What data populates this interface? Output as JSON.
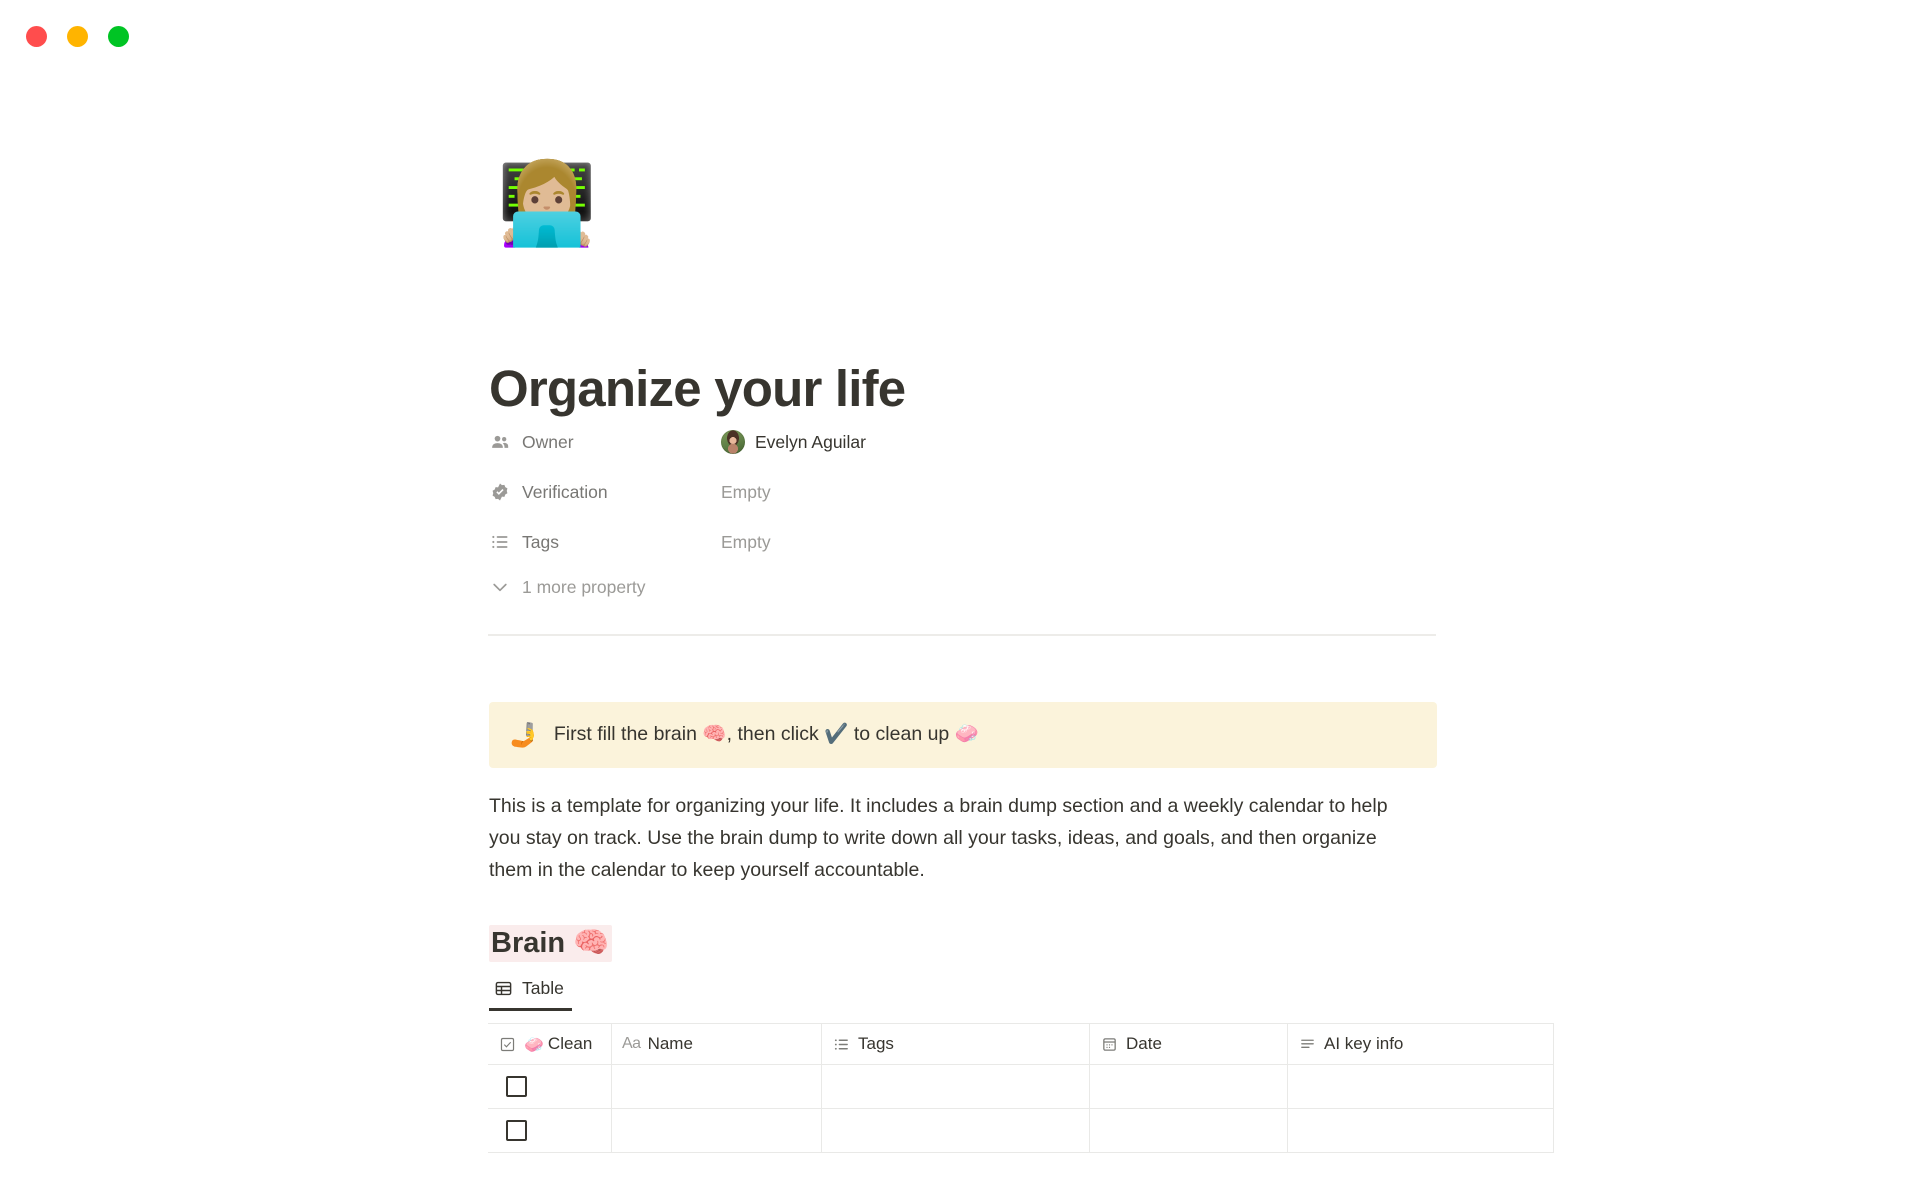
{
  "window": {
    "traffic_lights": [
      {
        "name": "close-button",
        "color": "#FF4D4D"
      },
      {
        "name": "minimize-button",
        "color": "#FFB400"
      },
      {
        "name": "maximize-button",
        "color": "#00C424"
      }
    ]
  },
  "page": {
    "emoji": "👩🏼‍💻",
    "title": "Organize your life"
  },
  "properties": {
    "rows": [
      {
        "icon": "people-icon",
        "label": "Owner",
        "value": "Evelyn Aguilar",
        "empty": false,
        "has_avatar": true
      },
      {
        "icon": "verified-badge-icon",
        "label": "Verification",
        "value": "Empty",
        "empty": true,
        "has_avatar": false
      },
      {
        "icon": "multi-select-icon",
        "label": "Tags",
        "value": "Empty",
        "empty": true,
        "has_avatar": false
      }
    ],
    "more_label": "1 more property",
    "more_icon": "chevron-down-icon"
  },
  "callout": {
    "emoji": "🤳",
    "text": "First fill the brain 🧠, then click ✔️ to clean up 🧼",
    "background": "#FBF3DB"
  },
  "intro": {
    "paragraph": "This is a template for organizing your life. It includes a brain dump section and a weekly calendar to help you stay on track. Use the brain dump to write down all your tasks, ideas, and goals, and then organize them in the calendar to keep yourself accountable."
  },
  "brain_section": {
    "heading": "Brain 🧠",
    "highlight_color": "#FAECEC",
    "tabs": [
      {
        "label": "Table",
        "icon": "table-icon",
        "active": true
      }
    ],
    "table": {
      "columns": [
        {
          "label": "Clean",
          "icon": "checkbox-icon",
          "emoji": "🧼",
          "dark": true
        },
        {
          "label": "Name",
          "icon": "title-aa-icon",
          "emoji": "",
          "dark": false
        },
        {
          "label": "Tags",
          "icon": "multi-select-icon",
          "emoji": "",
          "dark": false
        },
        {
          "label": "Date",
          "icon": "calendar-icon",
          "emoji": "",
          "dark": false
        },
        {
          "label": "AI key info",
          "icon": "text-lines-icon",
          "emoji": "",
          "dark": false
        }
      ],
      "rows": [
        {
          "clean": false,
          "name": "",
          "tags": "",
          "date": "",
          "ai_key_info": ""
        },
        {
          "clean": false,
          "name": "",
          "tags": "",
          "date": "",
          "ai_key_info": ""
        }
      ]
    }
  }
}
